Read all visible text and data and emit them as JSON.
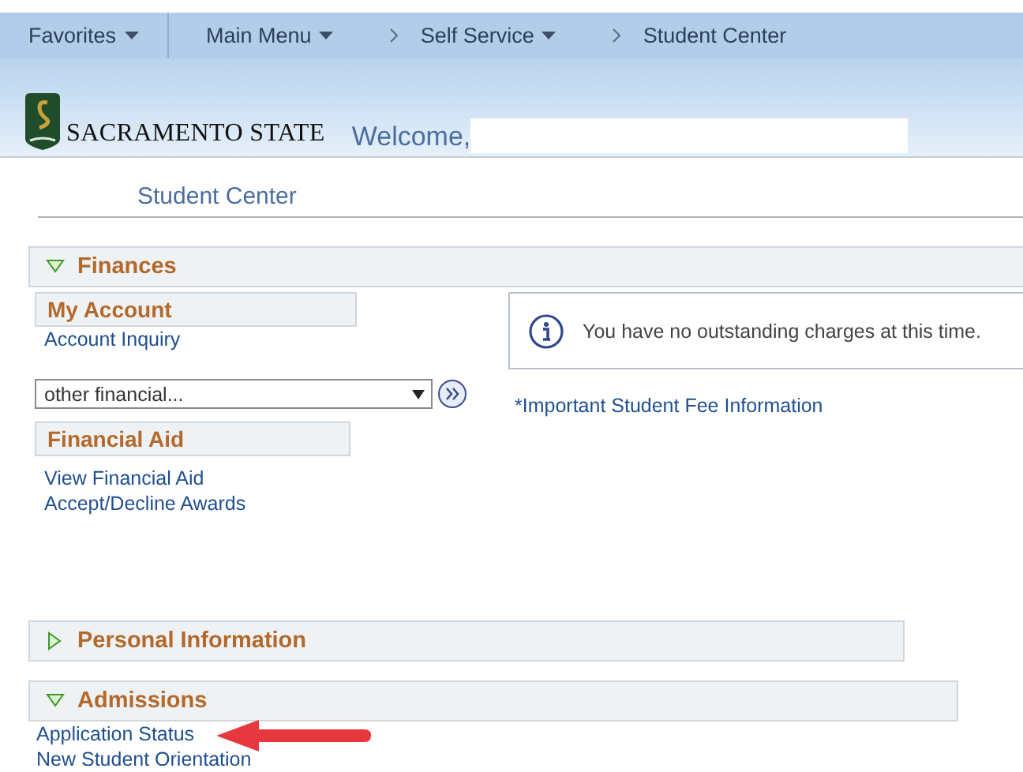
{
  "nav": {
    "items": [
      {
        "kind": "menu",
        "label": "Favorites",
        "dropdown": true
      },
      {
        "kind": "menu",
        "label": "Main Menu",
        "dropdown": true
      },
      {
        "kind": "crumb",
        "label": "Self Service",
        "dropdown": true
      },
      {
        "kind": "crumb",
        "label": "Student Center",
        "dropdown": false
      }
    ]
  },
  "header": {
    "logo_text": "SACRAMENTO STATE",
    "welcome": "Welcome,"
  },
  "page_title": "Student Center",
  "sections": [
    {
      "kind": "finances",
      "title": "Finances",
      "expanded": true,
      "my_account": {
        "title": "My Account",
        "links": [
          "Account Inquiry"
        ]
      },
      "select": {
        "value": "other financial..."
      },
      "financial_aid": {
        "title": "Financial Aid",
        "links": [
          "View Financial Aid",
          "Accept/Decline Awards"
        ]
      },
      "notice": "You have no outstanding charges at this time.",
      "fee_link": "*Important Student Fee Information"
    },
    {
      "kind": "links",
      "title": "Personal Information",
      "expanded": false
    },
    {
      "kind": "links",
      "title": "Admissions",
      "expanded": true,
      "links": [
        "Application Status",
        "New Student Orientation"
      ]
    }
  ]
}
